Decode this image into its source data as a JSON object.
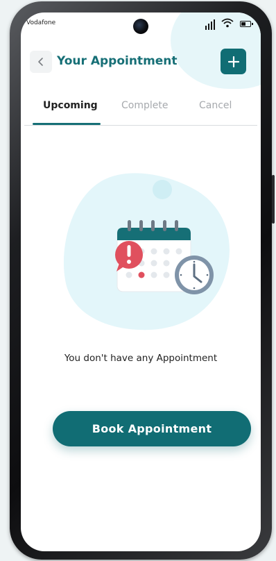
{
  "status_bar": {
    "carrier": "Vodafone",
    "icons": [
      "signal-icon",
      "wifi-icon",
      "battery-icon"
    ]
  },
  "header": {
    "back_icon": "chevron-left-icon",
    "title": "Your Appointment",
    "add_icon": "plus-icon",
    "add_label": "+"
  },
  "tabs": [
    {
      "label": "Upcoming",
      "active": true
    },
    {
      "label": "Complete",
      "active": false
    },
    {
      "label": "Cancel",
      "active": false
    }
  ],
  "empty_state": {
    "illustration": "calendar-alert-clock-illustration",
    "message": "You don't have any Appointment"
  },
  "actions": {
    "book_label": "Book Appointment"
  },
  "colors": {
    "primary": "#116d74",
    "title": "#166f76",
    "blob": "#e3f6fa",
    "alert": "#e0505e",
    "clock": "#7f93a8"
  }
}
